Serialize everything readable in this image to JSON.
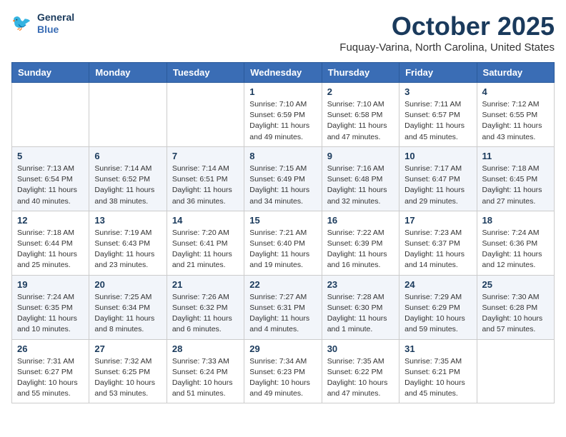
{
  "header": {
    "logo_line1": "General",
    "logo_line2": "Blue",
    "month": "October 2025",
    "location": "Fuquay-Varina, North Carolina, United States"
  },
  "weekdays": [
    "Sunday",
    "Monday",
    "Tuesday",
    "Wednesday",
    "Thursday",
    "Friday",
    "Saturday"
  ],
  "weeks": [
    [
      {
        "day": "",
        "info": ""
      },
      {
        "day": "",
        "info": ""
      },
      {
        "day": "",
        "info": ""
      },
      {
        "day": "1",
        "info": "Sunrise: 7:10 AM\nSunset: 6:59 PM\nDaylight: 11 hours\nand 49 minutes."
      },
      {
        "day": "2",
        "info": "Sunrise: 7:10 AM\nSunset: 6:58 PM\nDaylight: 11 hours\nand 47 minutes."
      },
      {
        "day": "3",
        "info": "Sunrise: 7:11 AM\nSunset: 6:57 PM\nDaylight: 11 hours\nand 45 minutes."
      },
      {
        "day": "4",
        "info": "Sunrise: 7:12 AM\nSunset: 6:55 PM\nDaylight: 11 hours\nand 43 minutes."
      }
    ],
    [
      {
        "day": "5",
        "info": "Sunrise: 7:13 AM\nSunset: 6:54 PM\nDaylight: 11 hours\nand 40 minutes."
      },
      {
        "day": "6",
        "info": "Sunrise: 7:14 AM\nSunset: 6:52 PM\nDaylight: 11 hours\nand 38 minutes."
      },
      {
        "day": "7",
        "info": "Sunrise: 7:14 AM\nSunset: 6:51 PM\nDaylight: 11 hours\nand 36 minutes."
      },
      {
        "day": "8",
        "info": "Sunrise: 7:15 AM\nSunset: 6:49 PM\nDaylight: 11 hours\nand 34 minutes."
      },
      {
        "day": "9",
        "info": "Sunrise: 7:16 AM\nSunset: 6:48 PM\nDaylight: 11 hours\nand 32 minutes."
      },
      {
        "day": "10",
        "info": "Sunrise: 7:17 AM\nSunset: 6:47 PM\nDaylight: 11 hours\nand 29 minutes."
      },
      {
        "day": "11",
        "info": "Sunrise: 7:18 AM\nSunset: 6:45 PM\nDaylight: 11 hours\nand 27 minutes."
      }
    ],
    [
      {
        "day": "12",
        "info": "Sunrise: 7:18 AM\nSunset: 6:44 PM\nDaylight: 11 hours\nand 25 minutes."
      },
      {
        "day": "13",
        "info": "Sunrise: 7:19 AM\nSunset: 6:43 PM\nDaylight: 11 hours\nand 23 minutes."
      },
      {
        "day": "14",
        "info": "Sunrise: 7:20 AM\nSunset: 6:41 PM\nDaylight: 11 hours\nand 21 minutes."
      },
      {
        "day": "15",
        "info": "Sunrise: 7:21 AM\nSunset: 6:40 PM\nDaylight: 11 hours\nand 19 minutes."
      },
      {
        "day": "16",
        "info": "Sunrise: 7:22 AM\nSunset: 6:39 PM\nDaylight: 11 hours\nand 16 minutes."
      },
      {
        "day": "17",
        "info": "Sunrise: 7:23 AM\nSunset: 6:37 PM\nDaylight: 11 hours\nand 14 minutes."
      },
      {
        "day": "18",
        "info": "Sunrise: 7:24 AM\nSunset: 6:36 PM\nDaylight: 11 hours\nand 12 minutes."
      }
    ],
    [
      {
        "day": "19",
        "info": "Sunrise: 7:24 AM\nSunset: 6:35 PM\nDaylight: 11 hours\nand 10 minutes."
      },
      {
        "day": "20",
        "info": "Sunrise: 7:25 AM\nSunset: 6:34 PM\nDaylight: 11 hours\nand 8 minutes."
      },
      {
        "day": "21",
        "info": "Sunrise: 7:26 AM\nSunset: 6:32 PM\nDaylight: 11 hours\nand 6 minutes."
      },
      {
        "day": "22",
        "info": "Sunrise: 7:27 AM\nSunset: 6:31 PM\nDaylight: 11 hours\nand 4 minutes."
      },
      {
        "day": "23",
        "info": "Sunrise: 7:28 AM\nSunset: 6:30 PM\nDaylight: 11 hours\nand 1 minute."
      },
      {
        "day": "24",
        "info": "Sunrise: 7:29 AM\nSunset: 6:29 PM\nDaylight: 10 hours\nand 59 minutes."
      },
      {
        "day": "25",
        "info": "Sunrise: 7:30 AM\nSunset: 6:28 PM\nDaylight: 10 hours\nand 57 minutes."
      }
    ],
    [
      {
        "day": "26",
        "info": "Sunrise: 7:31 AM\nSunset: 6:27 PM\nDaylight: 10 hours\nand 55 minutes."
      },
      {
        "day": "27",
        "info": "Sunrise: 7:32 AM\nSunset: 6:25 PM\nDaylight: 10 hours\nand 53 minutes."
      },
      {
        "day": "28",
        "info": "Sunrise: 7:33 AM\nSunset: 6:24 PM\nDaylight: 10 hours\nand 51 minutes."
      },
      {
        "day": "29",
        "info": "Sunrise: 7:34 AM\nSunset: 6:23 PM\nDaylight: 10 hours\nand 49 minutes."
      },
      {
        "day": "30",
        "info": "Sunrise: 7:35 AM\nSunset: 6:22 PM\nDaylight: 10 hours\nand 47 minutes."
      },
      {
        "day": "31",
        "info": "Sunrise: 7:35 AM\nSunset: 6:21 PM\nDaylight: 10 hours\nand 45 minutes."
      },
      {
        "day": "",
        "info": ""
      }
    ]
  ]
}
